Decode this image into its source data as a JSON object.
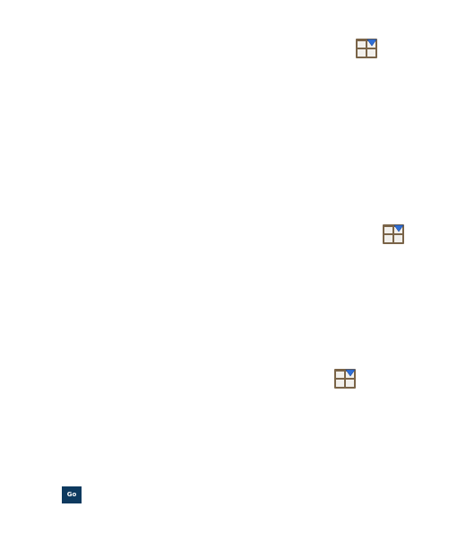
{
  "grid_buttons": [
    {
      "icon": "grid-dropdown-icon"
    },
    {
      "icon": "grid-dropdown-icon"
    },
    {
      "icon": "grid-dropdown-icon"
    }
  ],
  "go_button": {
    "label": "Go",
    "color": "#0e3a5f"
  },
  "colors": {
    "icon_frame": "#7a6448",
    "icon_tile": "#f2f0ec",
    "icon_badge": "#2f6fd6"
  }
}
